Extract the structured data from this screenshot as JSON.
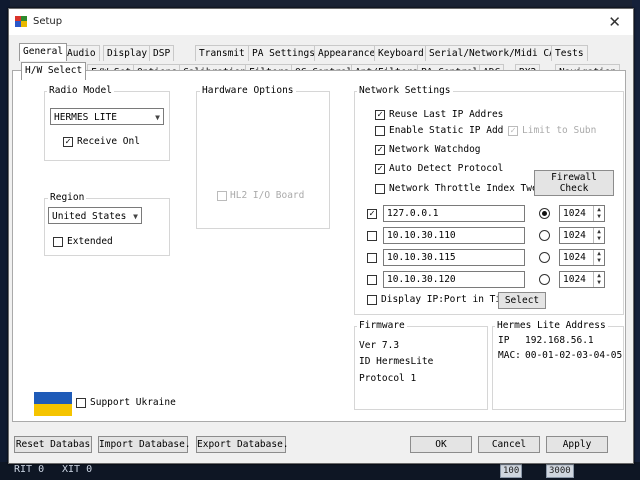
{
  "window": {
    "title": "Setup"
  },
  "tabs_top": [
    "General",
    "Audio",
    "Display",
    "DSP",
    "Transmit",
    "PA Settings",
    "Appearance",
    "Keyboard",
    "Serial/Network/Midi CAT",
    "Tests"
  ],
  "tabs_sub": [
    "H/W Select",
    "F/W Set",
    "Options",
    "Calibration",
    "Filters",
    "OC Control",
    "Ant/Filters",
    "PA Control",
    "ADC",
    "RX2",
    "Navigation"
  ],
  "radio_model": {
    "title": "Radio Model",
    "value": "HERMES LITE",
    "receive_only": "Receive Onl"
  },
  "hardware_options": {
    "title": "Hardware Options",
    "hl2_io": "HL2 I/O Board"
  },
  "region": {
    "title": "Region",
    "value": "United States",
    "extended": "Extended"
  },
  "network": {
    "title": "Network Settings",
    "reuse_ip": "Reuse Last IP Addres",
    "enable_static": "Enable Static IP Add",
    "limit_subnet": "Limit to Subn",
    "watchdog": "Network Watchdog",
    "auto_detect": "Auto Detect Protocol",
    "throttle": "Network Throttle Index Twe",
    "firewall_btn": "Firewall Check",
    "ips": [
      {
        "ip": "127.0.0.1",
        "port": "1024",
        "checked": true,
        "selected": true
      },
      {
        "ip": "10.10.30.110",
        "port": "1024",
        "checked": false,
        "selected": false
      },
      {
        "ip": "10.10.30.115",
        "port": "1024",
        "checked": false,
        "selected": false
      },
      {
        "ip": "10.10.30.120",
        "port": "1024",
        "checked": false,
        "selected": false
      }
    ],
    "display_ip": "Display IP:Port in Tit",
    "select_btn": "Select"
  },
  "firmware": {
    "title": "Firmware",
    "ver": "Ver 7.3",
    "id": "ID  HermesLite",
    "protocol": "Protocol 1"
  },
  "address": {
    "title": "Hermes Lite Address",
    "ip_label": "IP",
    "ip": "192.168.56.1",
    "mac_label": "MAC:",
    "mac": "00-01-02-03-04-05"
  },
  "support_ukraine": "Support Ukraine",
  "buttons": {
    "reset": "Reset Databas",
    "import": "Import Database.",
    "export": "Export Database.",
    "ok": "OK",
    "cancel": "Cancel",
    "apply": "Apply"
  },
  "status": {
    "rit": "RIT 0",
    "xit": "XIT 0",
    "val1": "100",
    "val2": "3000"
  },
  "colors": {
    "flag_blue": "#1f5bb8",
    "flag_yellow": "#f5c400"
  }
}
